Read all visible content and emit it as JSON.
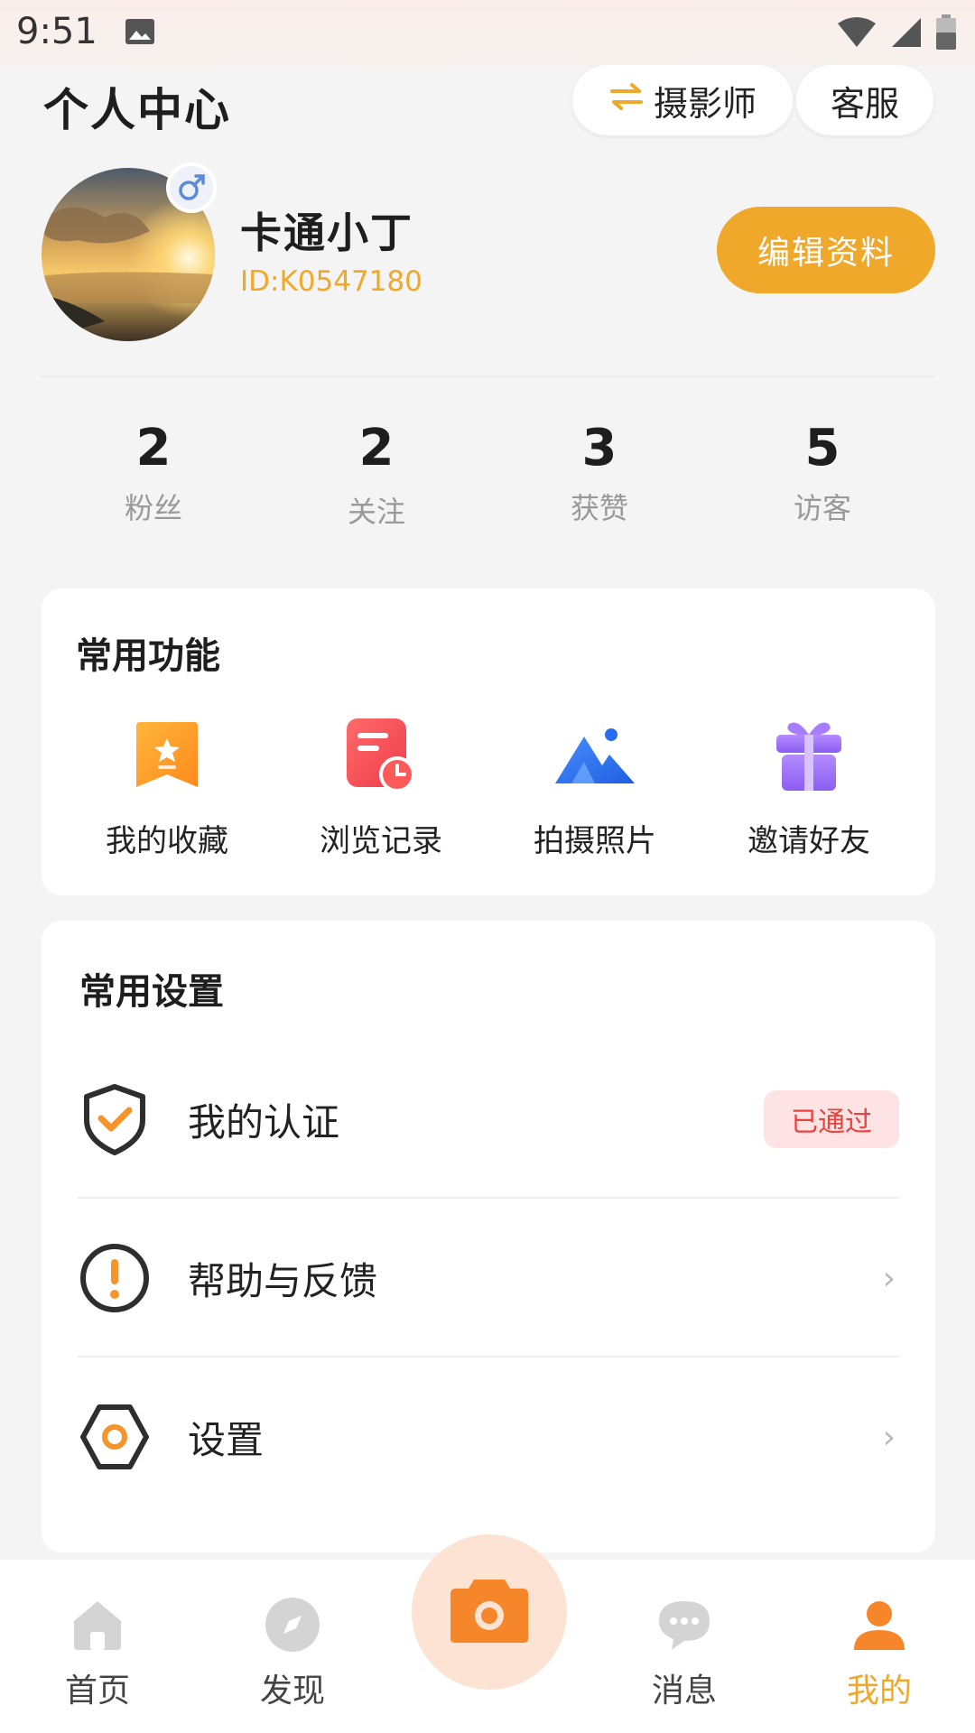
{
  "status_bar": {
    "time": "9:51"
  },
  "header": {
    "title": "个人中心",
    "switch_label": "摄影师",
    "service_label": "客服"
  },
  "profile": {
    "name": "卡通小丁",
    "id": "ID:K0547180",
    "edit_label": "编辑资料",
    "gender_symbol": "♂"
  },
  "stats": [
    {
      "value": "2",
      "label": "粉丝"
    },
    {
      "value": "2",
      "label": "关注"
    },
    {
      "value": "3",
      "label": "获赞"
    },
    {
      "value": "5",
      "label": "访客"
    }
  ],
  "functions": {
    "title": "常用功能",
    "items": [
      {
        "label": "我的收藏",
        "icon": "favorites-icon"
      },
      {
        "label": "浏览记录",
        "icon": "history-icon"
      },
      {
        "label": "拍摄照片",
        "icon": "mountain-photo-icon"
      },
      {
        "label": "邀请好友",
        "icon": "gift-icon"
      }
    ]
  },
  "settings": {
    "title": "常用设置",
    "items": [
      {
        "label": "我的认证",
        "badge": "已通过",
        "icon": "shield-check-icon"
      },
      {
        "label": "帮助与反馈",
        "icon": "exclamation-circle-icon"
      },
      {
        "label": "设置",
        "icon": "hexagon-settings-icon"
      }
    ]
  },
  "bottom_nav": {
    "items": [
      {
        "label": "首页",
        "icon": "home-icon"
      },
      {
        "label": "发现",
        "icon": "compass-icon"
      },
      {
        "label": "消息",
        "icon": "chat-icon"
      },
      {
        "label": "我的",
        "icon": "user-icon",
        "active": true
      }
    ]
  },
  "colors": {
    "accent": "#f0a82a",
    "badge_bg": "#fde3e3",
    "badge_text": "#e8413e"
  }
}
